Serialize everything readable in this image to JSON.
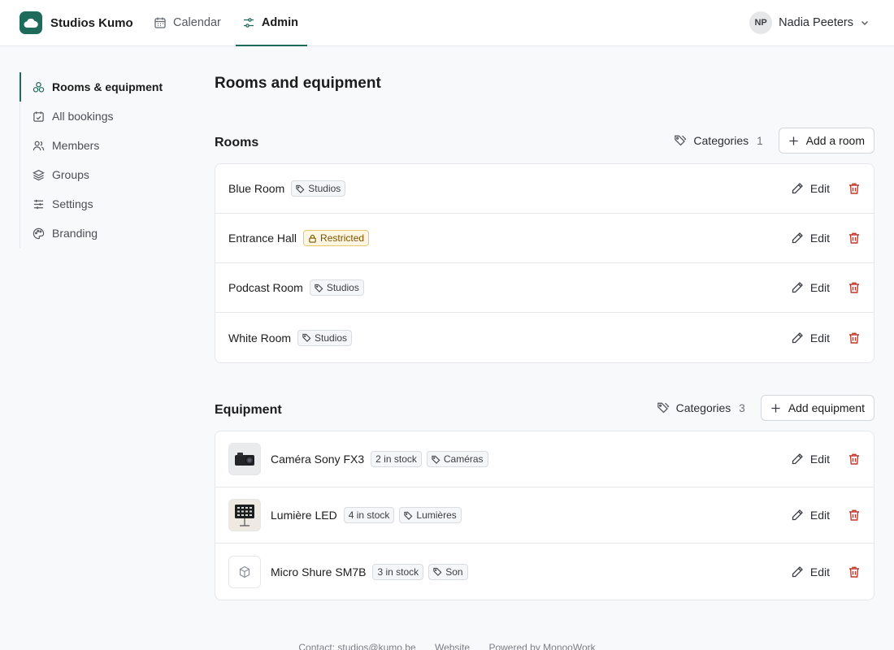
{
  "brand": {
    "name": "Studios Kumo",
    "color": "#1e6b5c"
  },
  "topnav": [
    {
      "label": "Calendar",
      "icon": "calendar-icon",
      "active": false
    },
    {
      "label": "Admin",
      "icon": "sliders-icon",
      "active": true
    }
  ],
  "user": {
    "initials": "NP",
    "name": "Nadia Peeters"
  },
  "sidebar": {
    "items": [
      {
        "label": "Rooms & equipment",
        "icon": "shapes-icon",
        "active": true
      },
      {
        "label": "All bookings",
        "icon": "calendar-check-icon",
        "active": false
      },
      {
        "label": "Members",
        "icon": "users-icon",
        "active": false
      },
      {
        "label": "Groups",
        "icon": "layers-icon",
        "active": false
      },
      {
        "label": "Settings",
        "icon": "sliders-icon",
        "active": false
      },
      {
        "label": "Branding",
        "icon": "palette-icon",
        "active": false
      }
    ]
  },
  "page": {
    "title": "Rooms and equipment"
  },
  "rooms": {
    "title": "Rooms",
    "categories_label": "Categories",
    "categories_count": "1",
    "add_label": "Add a room",
    "items": [
      {
        "name": "Blue Room",
        "tag": "Studios",
        "tag_type": "category"
      },
      {
        "name": "Entrance Hall",
        "tag": "Restricted",
        "tag_type": "restricted"
      },
      {
        "name": "Podcast Room",
        "tag": "Studios",
        "tag_type": "category"
      },
      {
        "name": "White Room",
        "tag": "Studios",
        "tag_type": "category"
      }
    ]
  },
  "equipment": {
    "title": "Equipment",
    "categories_label": "Categories",
    "categories_count": "3",
    "add_label": "Add equipment",
    "items": [
      {
        "name": "Caméra Sony FX3",
        "stock": "2 in stock",
        "tag": "Caméras",
        "thumb": "camera"
      },
      {
        "name": "Lumière LED",
        "stock": "4 in stock",
        "tag": "Lumières",
        "thumb": "led-panel"
      },
      {
        "name": "Micro Shure SM7B",
        "stock": "3 in stock",
        "tag": "Son",
        "thumb": "box"
      }
    ]
  },
  "actions": {
    "edit_label": "Edit"
  },
  "footer": {
    "contact": "Contact: studios@kumo.be",
    "website": "Website",
    "powered": "Powered by MonooWork"
  },
  "colors": {
    "accent": "#1e6b5c",
    "danger": "#c0392b",
    "restricted_bg": "#fdf6e3"
  }
}
